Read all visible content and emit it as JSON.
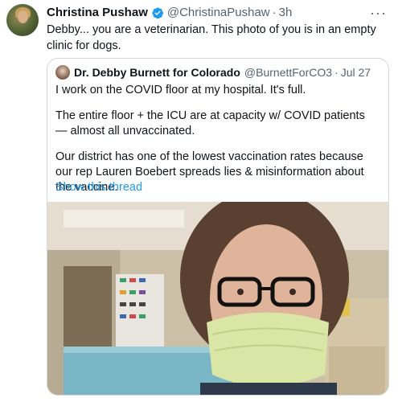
{
  "tweet": {
    "author_name": "Christina Pushaw",
    "handle": "@ChristinaPushaw",
    "separator": "·",
    "time": "3h",
    "text": "Debby... you are a veterinarian. This photo of you is in an empty clinic for dogs.",
    "more_icon": "more-horizontal-icon"
  },
  "quoted": {
    "author_name": "Dr. Debby Burnett for Colorado",
    "handle": "@BurnettForCO3",
    "separator": "·",
    "date": "Jul 27",
    "paragraphs": [
      "I work on the COVID floor at my hospital. It's full.",
      "The entire floor + the ICU are at capacity w/ COVID patients — almost all unvaccinated.",
      "Our district has one of the lowest vaccination rates because our rep Lauren Boebert spreads lies & misinformation about the vaccine."
    ],
    "show_thread": "Show this thread"
  },
  "colors": {
    "link": "#1d9bf0",
    "secondary_text": "#536471",
    "verified": "#1d9bf0",
    "border": "#cfd9de"
  }
}
